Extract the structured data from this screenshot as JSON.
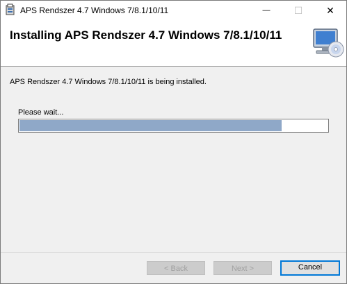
{
  "window": {
    "title": "APS Rendszer 4.7 Windows 7/8.1/10/11",
    "minimize_glyph": "—",
    "maximize_glyph": "☐",
    "close_glyph": "✕"
  },
  "banner": {
    "heading": "Installing APS Rendszer 4.7 Windows 7/8.1/10/11",
    "icon": "computer-disc-icon"
  },
  "body": {
    "status_text": "APS Rendszer 4.7 Windows 7/8.1/10/11 is being installed.",
    "wait_label": "Please wait...",
    "progress_fraction": 0.85
  },
  "buttons": {
    "back": "< Back",
    "next": "Next >",
    "cancel": "Cancel"
  },
  "colors": {
    "progress_fill": "#8fa8c8",
    "focus_border": "#0078d7"
  }
}
